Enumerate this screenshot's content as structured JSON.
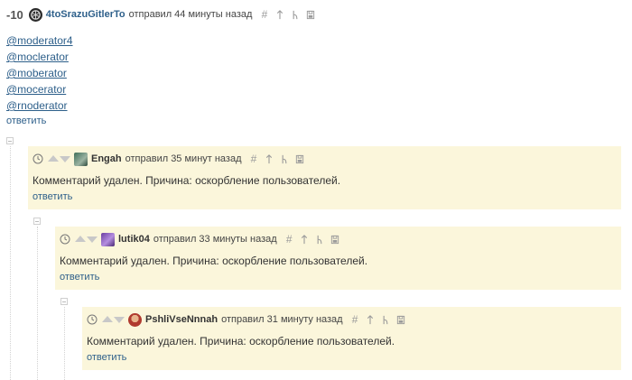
{
  "top_comment": {
    "score": "-10",
    "author": "4toSrazuGitlerTo",
    "posted": "отправил 44 минуты назад",
    "icons": [
      "hash-icon",
      "parent-arrow-icon",
      "thread-icon",
      "save-icon"
    ],
    "mentions": [
      "@moderator4",
      "@moclerator",
      "@moberator",
      "@mocerator",
      "@rnoderator"
    ],
    "reply_label": "ответить"
  },
  "replies": [
    {
      "author": "Engah",
      "posted": "отправил 35 минут назад",
      "text": "Комментарий удален. Причина: оскорбление пользователей.",
      "reply_label": "ответить"
    },
    {
      "author": "lutik04",
      "posted": "отправил 33 минуты назад",
      "text": "Комментарий удален. Причина: оскорбление пользователей.",
      "reply_label": "ответить"
    },
    {
      "author": "PshliVseNnnah",
      "posted": "отправил 31 минуту назад",
      "text": "Комментарий удален. Причина: оскорбление пользователей.",
      "reply_label": "ответить"
    }
  ],
  "colors": {
    "link": "#2d5f8a",
    "reply_background": "#fbf6db",
    "icon_gray": "#9a9a9a"
  }
}
